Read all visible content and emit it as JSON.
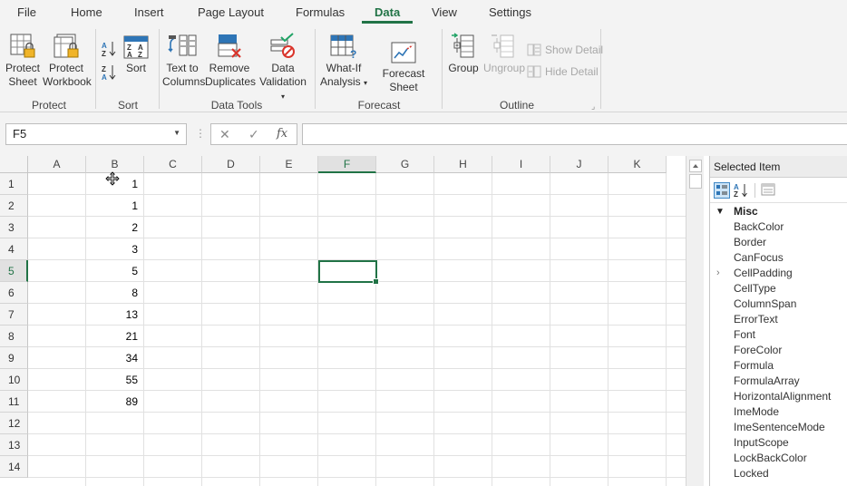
{
  "tabs": [
    {
      "label": "File",
      "active": false
    },
    {
      "label": "Home",
      "active": false
    },
    {
      "label": "Insert",
      "active": false
    },
    {
      "label": "Page Layout",
      "active": false
    },
    {
      "label": "Formulas",
      "active": false
    },
    {
      "label": "Data",
      "active": true
    },
    {
      "label": "View",
      "active": false
    },
    {
      "label": "Settings",
      "active": false
    }
  ],
  "ribbon": {
    "protect": {
      "group_label": "Protect",
      "protect_sheet": {
        "line1": "Protect",
        "line2": "Sheet"
      },
      "protect_workbook": {
        "line1": "Protect",
        "line2": "Workbook"
      }
    },
    "sort": {
      "group_label": "Sort",
      "sort_button": "Sort"
    },
    "data_tools": {
      "group_label": "Data Tools",
      "text_to_columns": {
        "line1": "Text to",
        "line2": "Columns"
      },
      "remove_duplicates": {
        "line1": "Remove",
        "line2": "Duplicates"
      },
      "data_validation": {
        "line1": "Data",
        "line2": "Validation"
      }
    },
    "forecast": {
      "group_label": "Forecast",
      "what_if": {
        "line1": "What-If",
        "line2": "Analysis"
      },
      "forecast_sheet": "Forecast Sheet"
    },
    "outline": {
      "group_label": "Outline",
      "group": "Group",
      "ungroup": "Ungroup",
      "show_detail": "Show Detail",
      "hide_detail": "Hide Detail"
    }
  },
  "formula_bar": {
    "name_box": "F5",
    "formula": ""
  },
  "grid": {
    "columns": [
      "A",
      "B",
      "C",
      "D",
      "E",
      "F",
      "G",
      "H",
      "I",
      "J",
      "K"
    ],
    "rows": [
      "1",
      "2",
      "3",
      "4",
      "5",
      "6",
      "7",
      "8",
      "9",
      "10",
      "11",
      "12",
      "13",
      "14"
    ],
    "column_b_values": [
      "1",
      "1",
      "2",
      "3",
      "5",
      "8",
      "13",
      "21",
      "34",
      "55",
      "89"
    ],
    "selected_cell": "F5"
  },
  "panel": {
    "title": "Selected Item",
    "category": "Misc",
    "properties": [
      "BackColor",
      "Border",
      "CanFocus",
      "CellPadding",
      "CellType",
      "ColumnSpan",
      "ErrorText",
      "Font",
      "ForeColor",
      "Formula",
      "FormulaArray",
      "HorizontalAlignment",
      "ImeMode",
      "ImeSentenceMode",
      "InputScope",
      "LockBackColor",
      "Locked"
    ],
    "expandable_property": "CellPadding"
  },
  "colors": {
    "accent": "#217346",
    "ribbon_bg": "#f3f3f3",
    "icon_blue": "#2e75b6"
  }
}
